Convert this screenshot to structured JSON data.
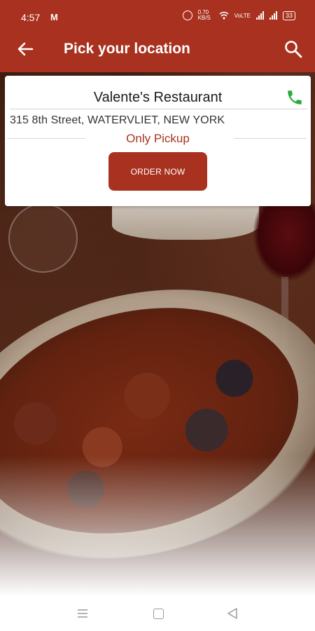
{
  "status_bar": {
    "time": "4:57",
    "carrier_icon": "M",
    "network_speed": "0.70 KB/S",
    "battery": "33"
  },
  "header": {
    "title": "Pick your location",
    "back_icon": "back-arrow-icon",
    "search_icon": "search-icon",
    "background_color": "#a8321f"
  },
  "restaurant_card": {
    "name": "Valente's Restaurant",
    "address": "315 8th Street, WATERVLIET, NEW YORK",
    "service_type": "Only Pickup",
    "order_button_label": "ORDER NOW",
    "phone_icon": "phone-icon",
    "phone_icon_color": "#2aaa3b",
    "accent_color": "#a8321f"
  },
  "nav_bar": {
    "items": [
      "menu-icon",
      "home-icon",
      "back-icon"
    ]
  }
}
